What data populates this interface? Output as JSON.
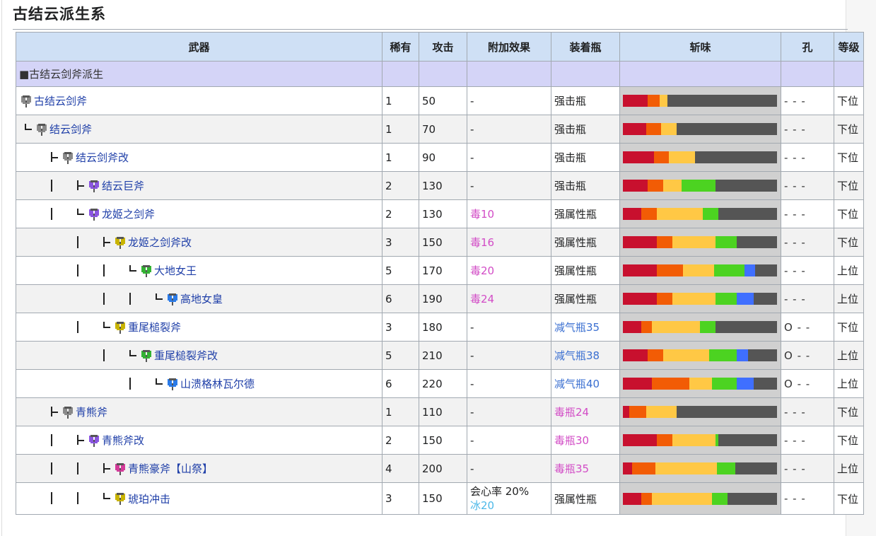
{
  "page": {
    "title": "古结云派生系"
  },
  "table": {
    "headers": [
      "武器",
      "稀有",
      "攻击",
      "附加效果",
      "装着瓶",
      "斩味",
      "孔",
      "等级"
    ],
    "group_label": "■古结云剑斧派生",
    "rows": [
      {
        "name": "古结云剑斧",
        "icon": "#8a8a8a",
        "indent": 0,
        "tree": [],
        "rarity": "1",
        "attack": "50",
        "effect": "-",
        "effect2": "",
        "effectColor": "",
        "phial": "强击瓶",
        "phialColor": "",
        "slots": "- - -",
        "rank": "下位",
        "sharp": [
          [
            16,
            "#c8102e"
          ],
          [
            8,
            "#f25c05"
          ],
          [
            5,
            "#ffc845"
          ],
          [
            71,
            "#555555"
          ]
        ]
      },
      {
        "name": "结云剑斧",
        "icon": "#8a8a8a",
        "indent": 0,
        "tree": [
          "end"
        ],
        "rarity": "1",
        "attack": "70",
        "effect": "-",
        "effect2": "",
        "effectColor": "",
        "phial": "强击瓶",
        "phialColor": "",
        "slots": "- - -",
        "rank": "下位",
        "sharp": [
          [
            15,
            "#c8102e"
          ],
          [
            10,
            "#f25c05"
          ],
          [
            10,
            "#ffc845"
          ],
          [
            65,
            "#555555"
          ]
        ]
      },
      {
        "name": "结云剑斧改",
        "icon": "#8a8a8a",
        "indent": 1,
        "tree": [
          "tee"
        ],
        "rarity": "1",
        "attack": "90",
        "effect": "-",
        "effect2": "",
        "effectColor": "",
        "phial": "强击瓶",
        "phialColor": "",
        "slots": "- - -",
        "rank": "下位",
        "sharp": [
          [
            20,
            "#c8102e"
          ],
          [
            10,
            "#f25c05"
          ],
          [
            17,
            "#ffc845"
          ],
          [
            53,
            "#555555"
          ]
        ]
      },
      {
        "name": "结云巨斧",
        "icon": "#8a55e0",
        "indent": 2,
        "tree": [
          "bar",
          "tee"
        ],
        "rarity": "2",
        "attack": "130",
        "effect": "-",
        "effect2": "",
        "effectColor": "",
        "phial": "强击瓶",
        "phialColor": "",
        "slots": "- - -",
        "rank": "下位",
        "sharp": [
          [
            16,
            "#c8102e"
          ],
          [
            10,
            "#f25c05"
          ],
          [
            12,
            "#ffc845"
          ],
          [
            22,
            "#4cd321"
          ],
          [
            40,
            "#555555"
          ]
        ]
      },
      {
        "name": "龙姬之剑斧",
        "icon": "#8a55e0",
        "indent": 2,
        "tree": [
          "bar",
          "end"
        ],
        "rarity": "2",
        "attack": "130",
        "effect": "毒10",
        "effect2": "",
        "effectColor": "pink",
        "phial": "强属性瓶",
        "phialColor": "",
        "slots": "- - -",
        "rank": "下位",
        "sharp": [
          [
            12,
            "#c8102e"
          ],
          [
            10,
            "#f25c05"
          ],
          [
            30,
            "#ffc845"
          ],
          [
            10,
            "#4cd321"
          ],
          [
            38,
            "#555555"
          ]
        ]
      },
      {
        "name": "龙姬之剑斧改",
        "icon": "#c9b400",
        "indent": 3,
        "tree": [
          "bar",
          "tee"
        ],
        "rarity": "3",
        "attack": "150",
        "effect": "毒16",
        "effect2": "",
        "effectColor": "pink",
        "phial": "强属性瓶",
        "phialColor": "",
        "slots": "- - -",
        "rank": "下位",
        "sharp": [
          [
            22,
            "#c8102e"
          ],
          [
            10,
            "#f25c05"
          ],
          [
            28,
            "#ffc845"
          ],
          [
            14,
            "#4cd321"
          ],
          [
            26,
            "#555555"
          ]
        ]
      },
      {
        "name": "大地女王",
        "icon": "#33b233",
        "indent": 4,
        "tree": [
          "bar",
          "bar",
          "end"
        ],
        "rarity": "5",
        "attack": "170",
        "effect": "毒20",
        "effect2": "",
        "effectColor": "pink",
        "phial": "强属性瓶",
        "phialColor": "",
        "slots": "- - -",
        "rank": "上位",
        "sharp": [
          [
            22,
            "#c8102e"
          ],
          [
            17,
            "#f25c05"
          ],
          [
            20,
            "#ffc845"
          ],
          [
            20,
            "#4cd321"
          ],
          [
            7,
            "#3f6fff"
          ],
          [
            14,
            "#555555"
          ]
        ]
      },
      {
        "name": "高地女皇",
        "icon": "#2b7be8",
        "indent": 5,
        "tree": [
          "bar",
          "bar",
          "end"
        ],
        "rarity": "6",
        "attack": "190",
        "effect": "毒24",
        "effect2": "",
        "effectColor": "pink",
        "phial": "强属性瓶",
        "phialColor": "",
        "slots": "- - -",
        "rank": "上位",
        "sharp": [
          [
            22,
            "#c8102e"
          ],
          [
            10,
            "#f25c05"
          ],
          [
            28,
            "#ffc845"
          ],
          [
            14,
            "#4cd321"
          ],
          [
            11,
            "#3f6fff"
          ],
          [
            15,
            "#555555"
          ]
        ]
      },
      {
        "name": "重尾槌裂斧",
        "icon": "#c9b400",
        "indent": 3,
        "tree": [
          "bar",
          "end"
        ],
        "rarity": "3",
        "attack": "180",
        "effect": "-",
        "effect2": "",
        "effectColor": "",
        "phial": "减气瓶35",
        "phialColor": "blue",
        "slots": "O - -",
        "rank": "下位",
        "sharp": [
          [
            12,
            "#c8102e"
          ],
          [
            7,
            "#f25c05"
          ],
          [
            31,
            "#ffc845"
          ],
          [
            10,
            "#4cd321"
          ],
          [
            40,
            "#555555"
          ]
        ]
      },
      {
        "name": "重尾槌裂斧改",
        "icon": "#33b233",
        "indent": 4,
        "tree": [
          "bar",
          "end"
        ],
        "rarity": "5",
        "attack": "210",
        "effect": "-",
        "effect2": "",
        "effectColor": "",
        "phial": "减气瓶38",
        "phialColor": "blue",
        "slots": "O - -",
        "rank": "上位",
        "sharp": [
          [
            16,
            "#c8102e"
          ],
          [
            10,
            "#f25c05"
          ],
          [
            30,
            "#ffc845"
          ],
          [
            18,
            "#4cd321"
          ],
          [
            7,
            "#3f6fff"
          ],
          [
            19,
            "#555555"
          ]
        ]
      },
      {
        "name": "山溃格林瓦尔德",
        "icon": "#2b7be8",
        "indent": 5,
        "tree": [
          "bar",
          "end"
        ],
        "rarity": "6",
        "attack": "220",
        "effect": "-",
        "effect2": "",
        "effectColor": "",
        "phial": "减气瓶40",
        "phialColor": "blue",
        "slots": "O - -",
        "rank": "上位",
        "sharp": [
          [
            19,
            "#c8102e"
          ],
          [
            24,
            "#f25c05"
          ],
          [
            15,
            "#ffc845"
          ],
          [
            16,
            "#4cd321"
          ],
          [
            11,
            "#3f6fff"
          ],
          [
            15,
            "#555555"
          ]
        ]
      },
      {
        "name": "青熊斧",
        "icon": "#8a8a8a",
        "indent": 1,
        "tree": [
          "tee"
        ],
        "rarity": "1",
        "attack": "110",
        "effect": "-",
        "effect2": "",
        "effectColor": "",
        "phial": "毒瓶24",
        "phialColor": "pink",
        "slots": "- - -",
        "rank": "下位",
        "sharp": [
          [
            4,
            "#c8102e"
          ],
          [
            11,
            "#f25c05"
          ],
          [
            20,
            "#ffc845"
          ],
          [
            65,
            "#555555"
          ]
        ]
      },
      {
        "name": "青熊斧改",
        "icon": "#8a55e0",
        "indent": 2,
        "tree": [
          "bar",
          "tee"
        ],
        "rarity": "2",
        "attack": "150",
        "effect": "-",
        "effect2": "",
        "effectColor": "",
        "phial": "毒瓶30",
        "phialColor": "pink",
        "slots": "- - -",
        "rank": "下位",
        "sharp": [
          [
            22,
            "#c8102e"
          ],
          [
            10,
            "#f25c05"
          ],
          [
            28,
            "#ffc845"
          ],
          [
            2,
            "#4cd321"
          ],
          [
            38,
            "#555555"
          ]
        ]
      },
      {
        "name": "青熊豪斧【山祭】",
        "icon": "#d43a9a",
        "indent": 3,
        "tree": [
          "bar",
          "bar",
          "tee"
        ],
        "rarity": "4",
        "attack": "200",
        "effect": "-",
        "effect2": "",
        "effectColor": "",
        "phial": "毒瓶35",
        "phialColor": "pink",
        "slots": "- - -",
        "rank": "上位",
        "sharp": [
          [
            6,
            "#c8102e"
          ],
          [
            15,
            "#f25c05"
          ],
          [
            40,
            "#ffc845"
          ],
          [
            12,
            "#4cd321"
          ],
          [
            27,
            "#555555"
          ]
        ]
      },
      {
        "name": "琥珀冲击",
        "icon": "#c9b400",
        "indent": 3,
        "tree": [
          "bar",
          "bar",
          "end"
        ],
        "rarity": "3",
        "attack": "150",
        "effect": "会心率 20%",
        "effect2": "冰20",
        "effectColor": "",
        "phial": "强属性瓶",
        "phialColor": "",
        "slots": "- - -",
        "rank": "下位",
        "sharp": [
          [
            12,
            "#c8102e"
          ],
          [
            7,
            "#f25c05"
          ],
          [
            39,
            "#ffc845"
          ],
          [
            10,
            "#4cd321"
          ],
          [
            32,
            "#555555"
          ]
        ]
      }
    ]
  }
}
